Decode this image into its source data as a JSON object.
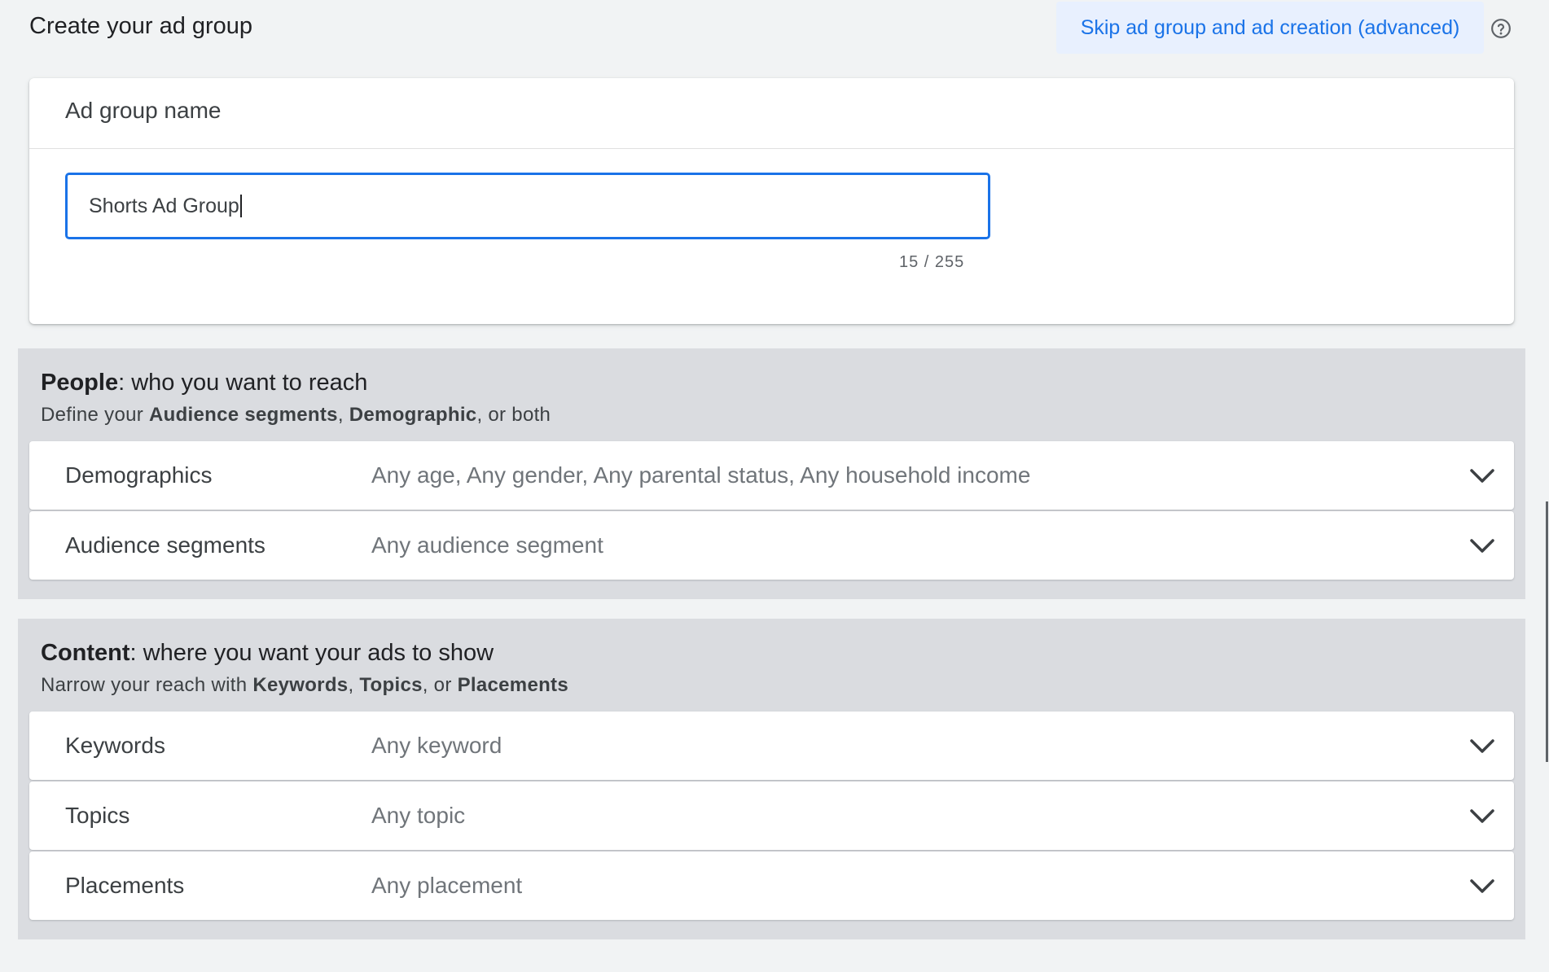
{
  "header": {
    "title": "Create your ad group",
    "skip_link": "Skip ad group and ad creation (advanced)",
    "help_icon": "help-circle-icon"
  },
  "ad_group": {
    "title": "Ad group name",
    "input_value": "Shorts Ad Group",
    "char_count": "15 / 255"
  },
  "people": {
    "heading_bold": "People",
    "heading_rest": ": who you want to reach",
    "sub_prefix": "Define your ",
    "sub_bold_1": "Audience segments",
    "sub_sep_1": ", ",
    "sub_bold_2": "Demographic",
    "sub_suffix": ", or both",
    "rows": [
      {
        "label": "Demographics",
        "value": "Any age, Any gender, Any parental status, Any household income"
      },
      {
        "label": "Audience segments",
        "value": "Any audience segment"
      }
    ]
  },
  "content": {
    "heading_bold": "Content",
    "heading_rest": ": where you want your ads to show",
    "sub_prefix": "Narrow your reach with ",
    "sub_bold_1": "Keywords",
    "sub_sep_1": ", ",
    "sub_bold_2": "Topics",
    "sub_sep_2": ", or ",
    "sub_bold_3": "Placements",
    "rows": [
      {
        "label": "Keywords",
        "value": "Any keyword"
      },
      {
        "label": "Topics",
        "value": "Any topic"
      },
      {
        "label": "Placements",
        "value": "Any placement"
      }
    ]
  },
  "colors": {
    "accent": "#1a73e8",
    "accent_bg": "#e8f0fe",
    "page_bg": "#f1f3f4",
    "section_bg": "#dadce0"
  }
}
